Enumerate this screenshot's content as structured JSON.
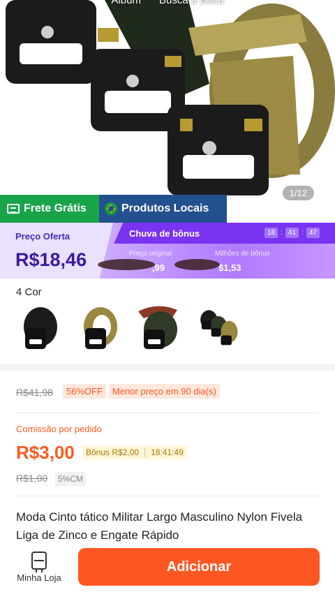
{
  "hero": {
    "tabs": [
      "Álbum",
      "Busca a Boca"
    ],
    "counter": "1/12"
  },
  "promo": {
    "free_shipping": "Frete Grátis",
    "local_products": "Produtos Locais"
  },
  "price_banner": {
    "offer_label": "Preço Oferta",
    "offer_price": "R$18,46",
    "bonus_title": "Chuva de bônus",
    "timer": [
      "18",
      "41",
      "47"
    ],
    "original_label": "Preço original",
    "original_value": ",99",
    "millions_label": "Milhões de bônus",
    "millions_value": "$1,53"
  },
  "colors": {
    "title": "4 Cor",
    "swatches": [
      "black-belt",
      "tan-belt",
      "green-belt",
      "set-belts"
    ]
  },
  "pricing": {
    "old_price": "R$41,98",
    "discount": "56%OFF",
    "lowest": "Menor preço em 90 dia(s)",
    "commission_label": "Comissão por pedido",
    "commission_price": "R$3,00",
    "bonus_text": "Bônus R$2,00",
    "bonus_timer": "18:41:49",
    "old_commission": "R$1,00",
    "cm_rate": "5%CM"
  },
  "product": {
    "title": "Moda Cinto tático Militar Largo Masculino Nylon Fivela Liga de Zinco e Engate Rápido"
  },
  "bottom_bar": {
    "store_label": "Minha Loja",
    "add_button": "Adicionar"
  },
  "colors_hex": {
    "accent": "#ff5722",
    "free_shipping_bg": "#1aa44a",
    "local_bg": "#23508e",
    "bonus_purple": "#7a33f0"
  }
}
